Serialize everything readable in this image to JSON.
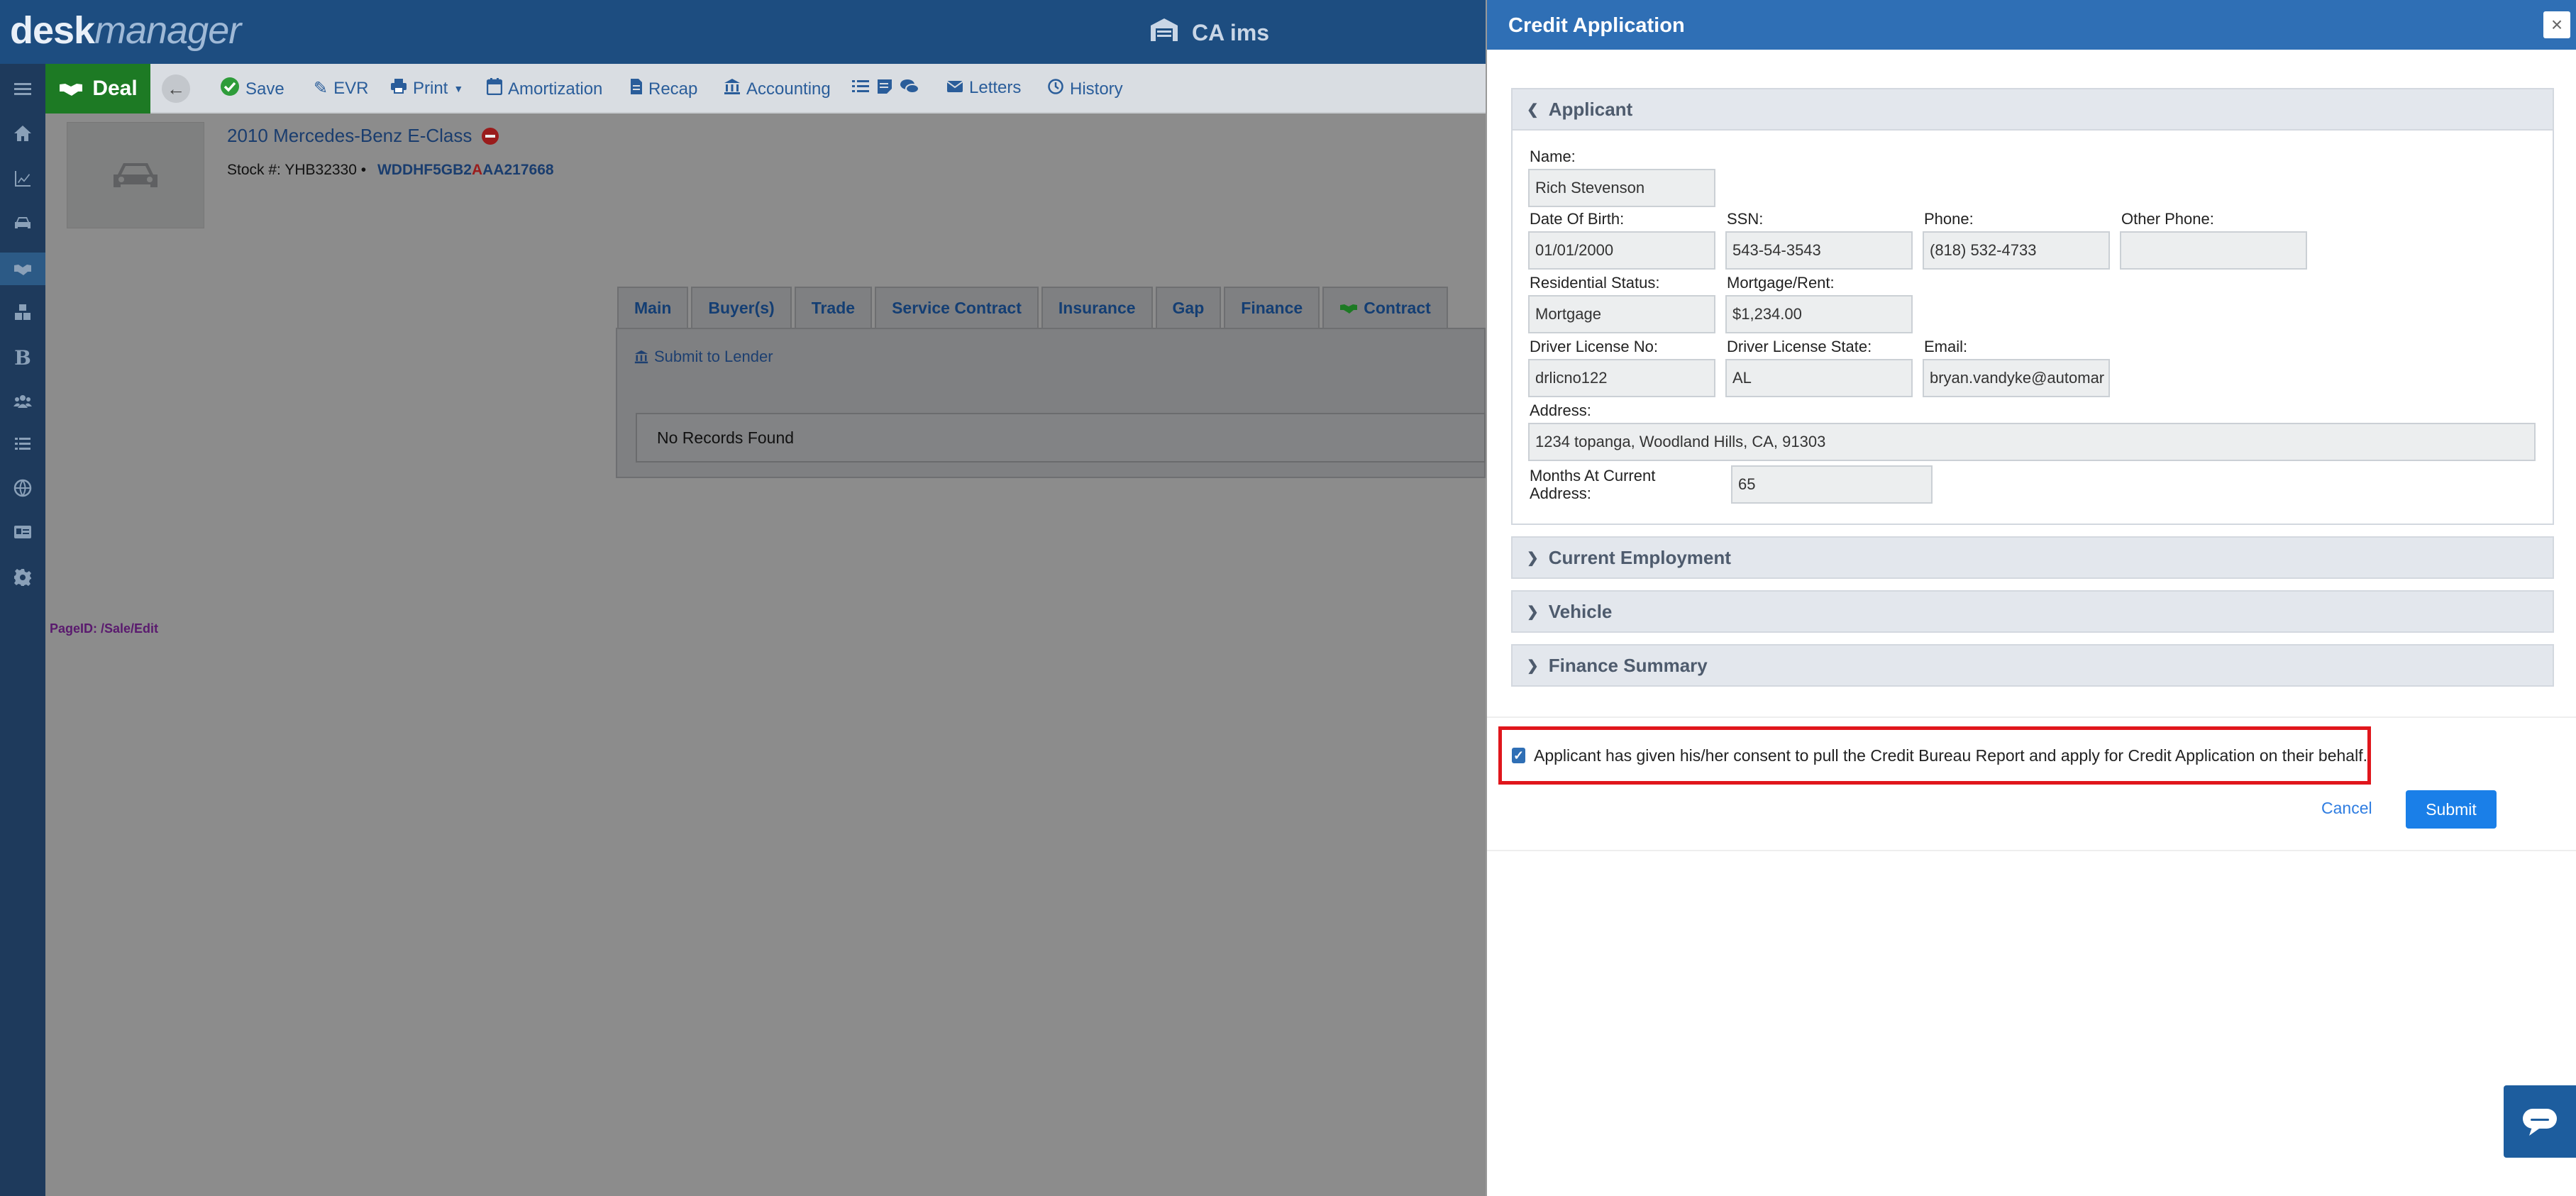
{
  "app": {
    "logo_bold": "desk",
    "logo_italic": "manager",
    "store_name": "CA ims"
  },
  "toolbar": {
    "deal_label": "Deal",
    "items": [
      {
        "label": "Save",
        "icon": "check-circle-icon"
      },
      {
        "label": "EVR",
        "icon": "edit-icon"
      },
      {
        "label": "Print",
        "icon": "print-icon"
      },
      {
        "label": "Amortization",
        "icon": "calendar-icon"
      },
      {
        "label": "Recap",
        "icon": "document-icon"
      },
      {
        "label": "Accounting",
        "icon": "bank-icon"
      },
      {
        "label": "Letters",
        "icon": "envelope-icon"
      },
      {
        "label": "History",
        "icon": "history-icon"
      }
    ]
  },
  "vehicle": {
    "title": "2010 Mercedes-Benz E-Class",
    "stock_label": "Stock #:",
    "stock_value": "YHB32330",
    "vin_pre": "WDDHF5GB2",
    "vin_red": "A",
    "vin_post": "AA217668"
  },
  "tabs": [
    "Main",
    "Buyer(s)",
    "Trade",
    "Service Contract",
    "Insurance",
    "Gap",
    "Finance",
    "Contract"
  ],
  "lender": {
    "submit_label": "Submit to Lender",
    "no_records": "No Records Found"
  },
  "page_id": "PageID:  /Sale/Edit",
  "modal": {
    "title": "Credit Application",
    "close": "×",
    "applicant_header": "Applicant",
    "fields": {
      "name_label": "Name:",
      "name_value": "Rich  Stevenson",
      "dob_label": "Date Of Birth:",
      "dob_value": "01/01/2000",
      "ssn_label": "SSN:",
      "ssn_value": "543-54-3543",
      "phone_label": "Phone:",
      "phone_value": "(818) 532-4733",
      "other_phone_label": "Other Phone:",
      "other_phone_value": "",
      "res_status_label": "Residential Status:",
      "res_status_value": "Mortgage",
      "mortgage_label": "Mortgage/Rent:",
      "mortgage_value": "$1,234.00",
      "dl_no_label": "Driver License No:",
      "dl_no_value": "drlicno122",
      "dl_state_label": "Driver License State:",
      "dl_state_value": "AL",
      "email_label": "Email:",
      "email_value": "bryan.vandyke@automar",
      "address_label": "Address:",
      "address_value": "1234 topanga, Woodland Hills, CA, 91303",
      "months_label_1": "Months At Current",
      "months_label_2": "Address:",
      "months_value": "65"
    },
    "sections": [
      "Current Employment",
      "Vehicle",
      "Finance Summary"
    ],
    "consent_text": "Applicant has given his/her consent to pull the Credit Bureau Report and apply for Credit Application on their behalf.",
    "consent_checked": true,
    "cancel_label": "Cancel",
    "submit_label": "Submit"
  }
}
